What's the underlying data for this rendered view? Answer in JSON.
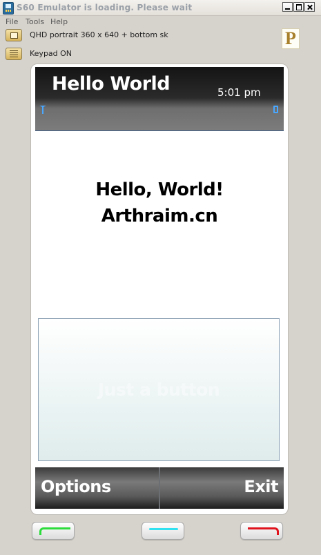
{
  "window": {
    "title": "S60 Emulator is loading. Please wait"
  },
  "menu": {
    "items": [
      "File",
      "Tools",
      "Help"
    ]
  },
  "toolbar": {
    "layout_label": "QHD portrait 360 x 640 + bottom sk",
    "keypad_label": "Keypad ON",
    "logo_letter": "P"
  },
  "phone": {
    "title": "Hello World",
    "clock": "5:01 pm",
    "lines": [
      "Hello, World!",
      "Arthraim.cn"
    ],
    "button_label": "Just a button",
    "softkeys": {
      "left": "Options",
      "right": "Exit"
    },
    "hardware_keys": [
      {
        "name": "call",
        "color": "#2bdc3a"
      },
      {
        "name": "menu",
        "color": "#31e1f0"
      },
      {
        "name": "end",
        "color": "#e0121b"
      }
    ]
  }
}
